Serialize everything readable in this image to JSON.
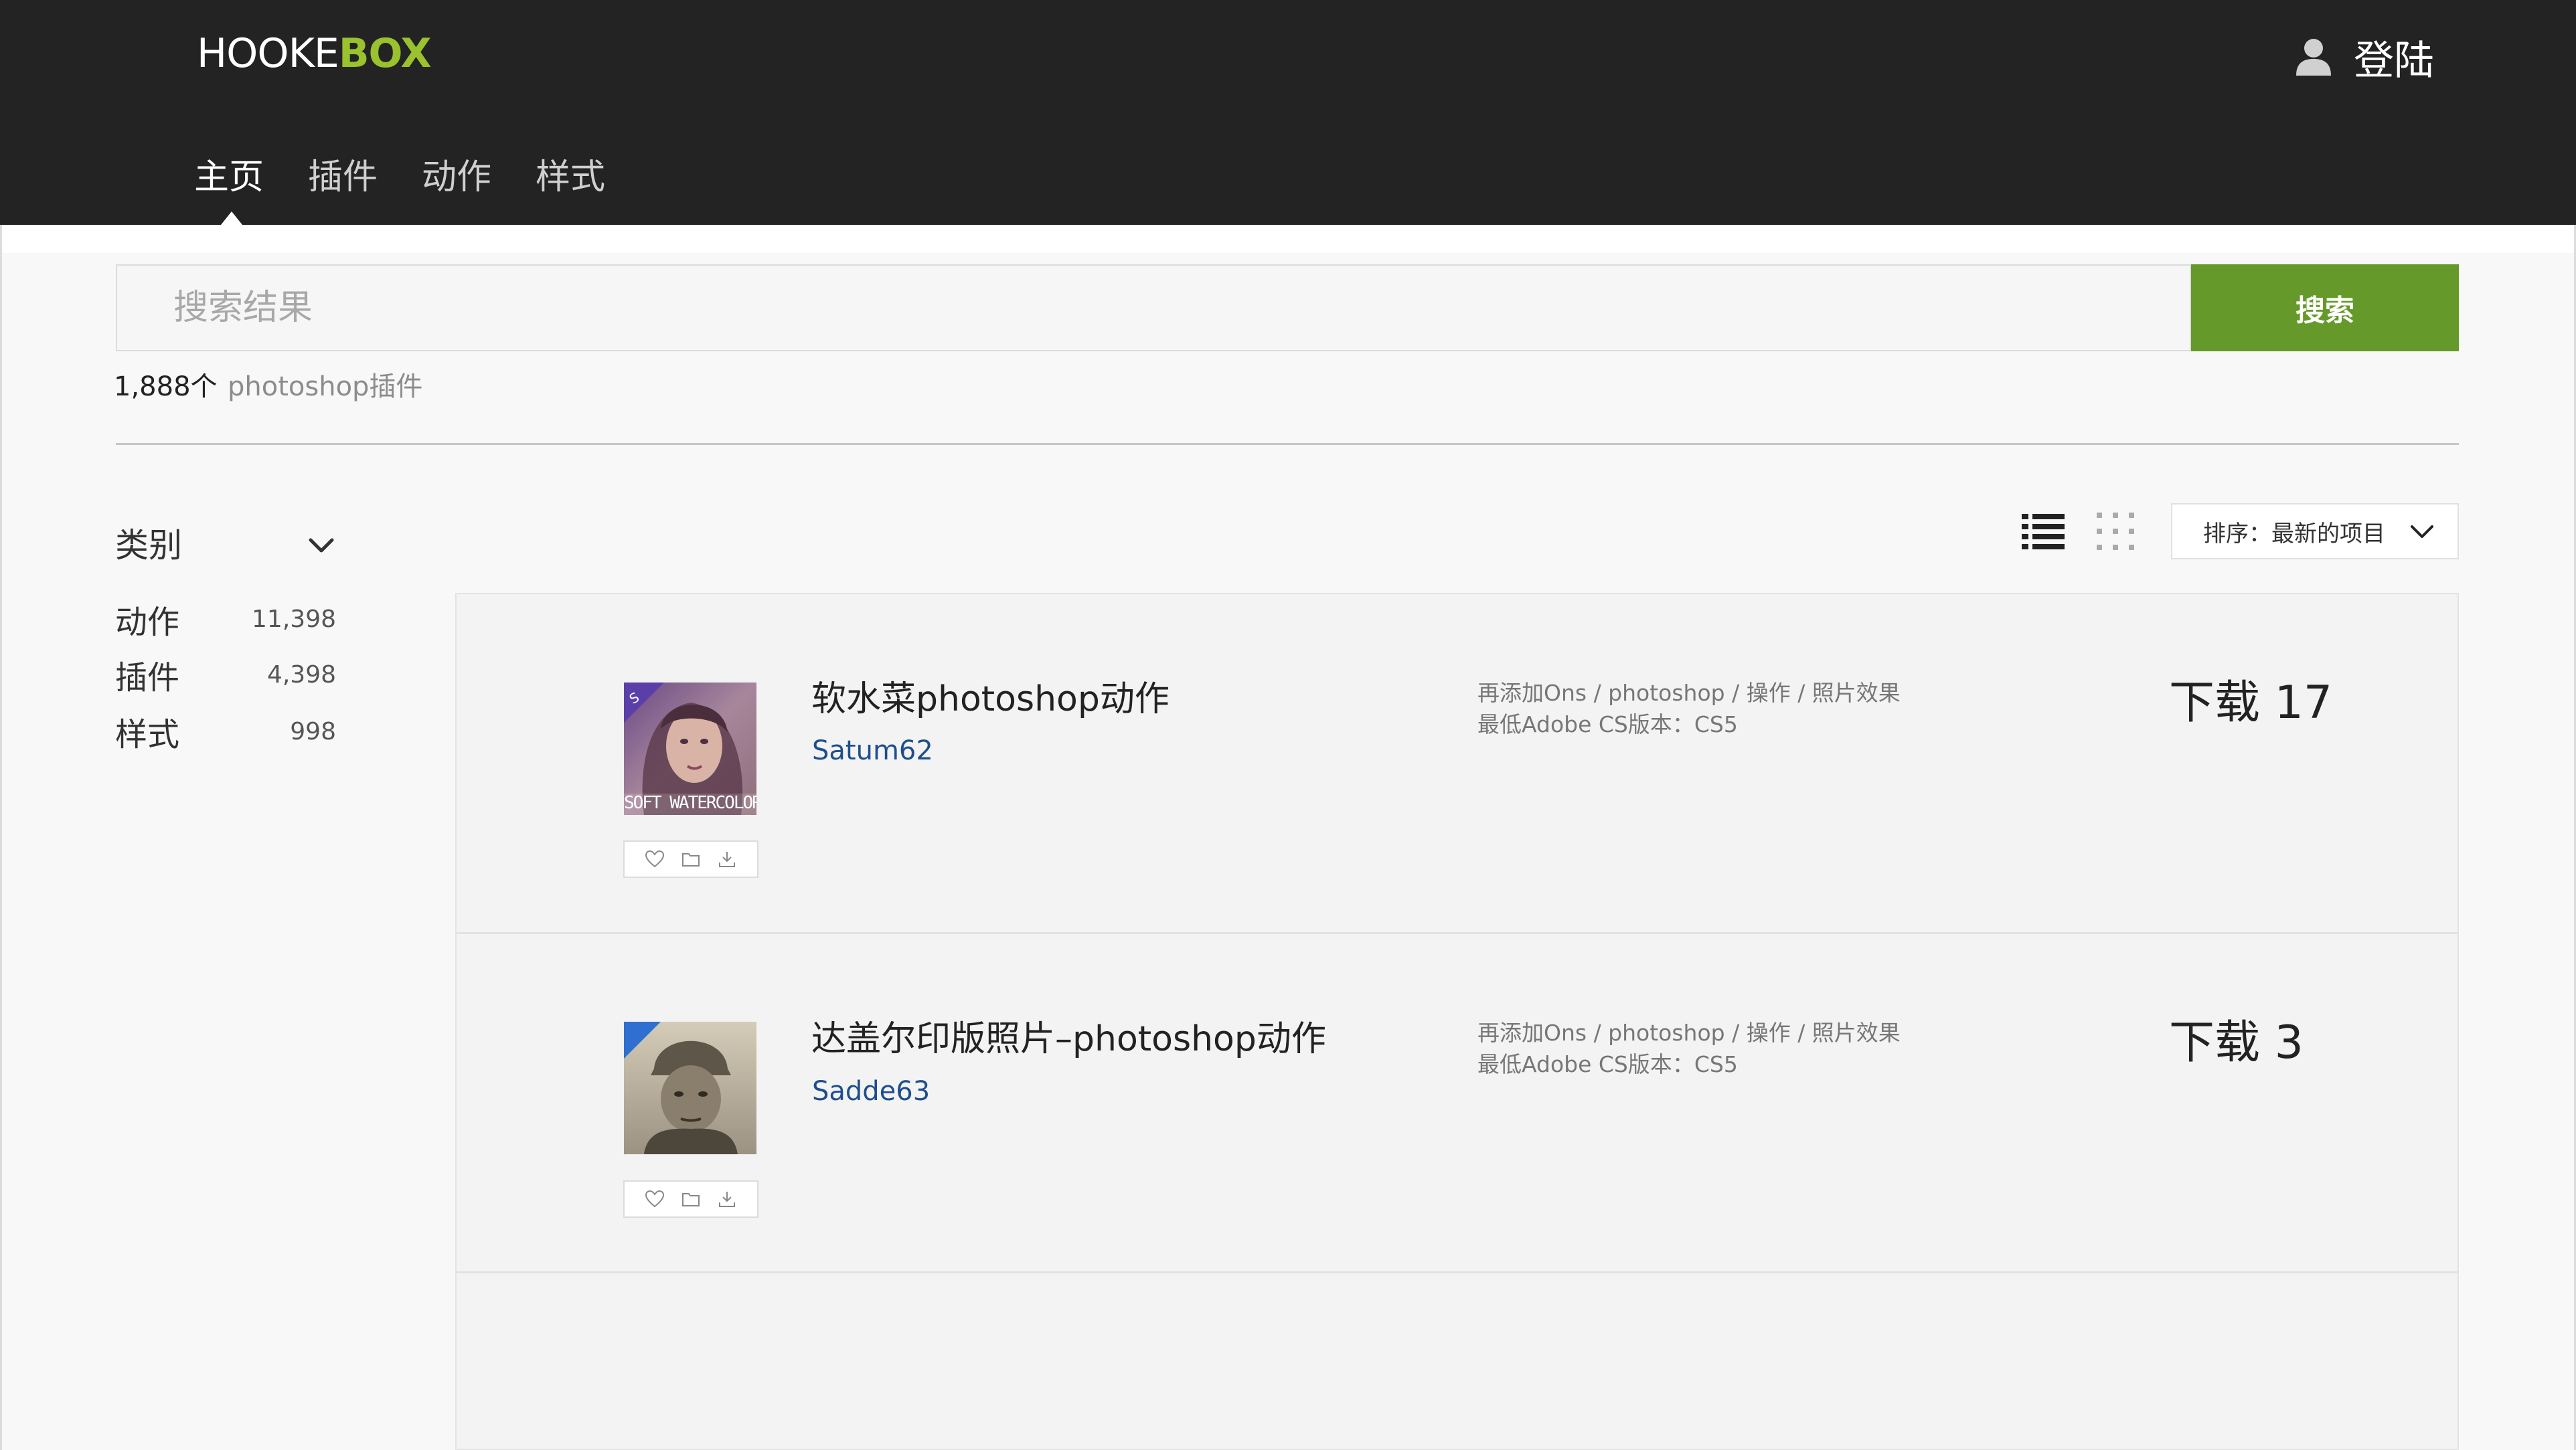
{
  "header": {
    "logo_part1": "HOOKE",
    "logo_part2": "BOX",
    "login_label": "登陆",
    "nav": [
      "主页",
      "插件",
      "动作",
      "样式"
    ]
  },
  "search": {
    "placeholder": "搜索结果",
    "button_label": "搜索",
    "result_count": "1,888个",
    "result_tag": "photoshop插件"
  },
  "sidebar": {
    "title": "类别",
    "items": [
      {
        "label": "动作",
        "count": "11,398"
      },
      {
        "label": "插件",
        "count": "4,398"
      },
      {
        "label": "样式",
        "count": "998"
      }
    ]
  },
  "toolbar": {
    "sort_label": "排序：最新的项目"
  },
  "results": [
    {
      "title": "软水菜photoshop动作",
      "author": "Satum62",
      "meta_path": "再添加Ons / photoshop / 操作 / 照片效果",
      "meta_version": "最低Adobe CS版本：CS5",
      "downloads": "下载 17",
      "thumb_text": "SOFT WATERCOLOR"
    },
    {
      "title": "达盖尔印版照片–photoshop动作",
      "author": "Sadde63",
      "meta_path": "再添加Ons / photoshop / 操作 / 照片效果",
      "meta_version": "最低Adobe CS版本：CS5",
      "downloads": "下载 3",
      "thumb_text": ""
    }
  ],
  "colors": {
    "header_bg": "#232323",
    "brand_green": "#9ac12e",
    "search_button": "#659a2a",
    "author_link": "#1e4e8c"
  }
}
